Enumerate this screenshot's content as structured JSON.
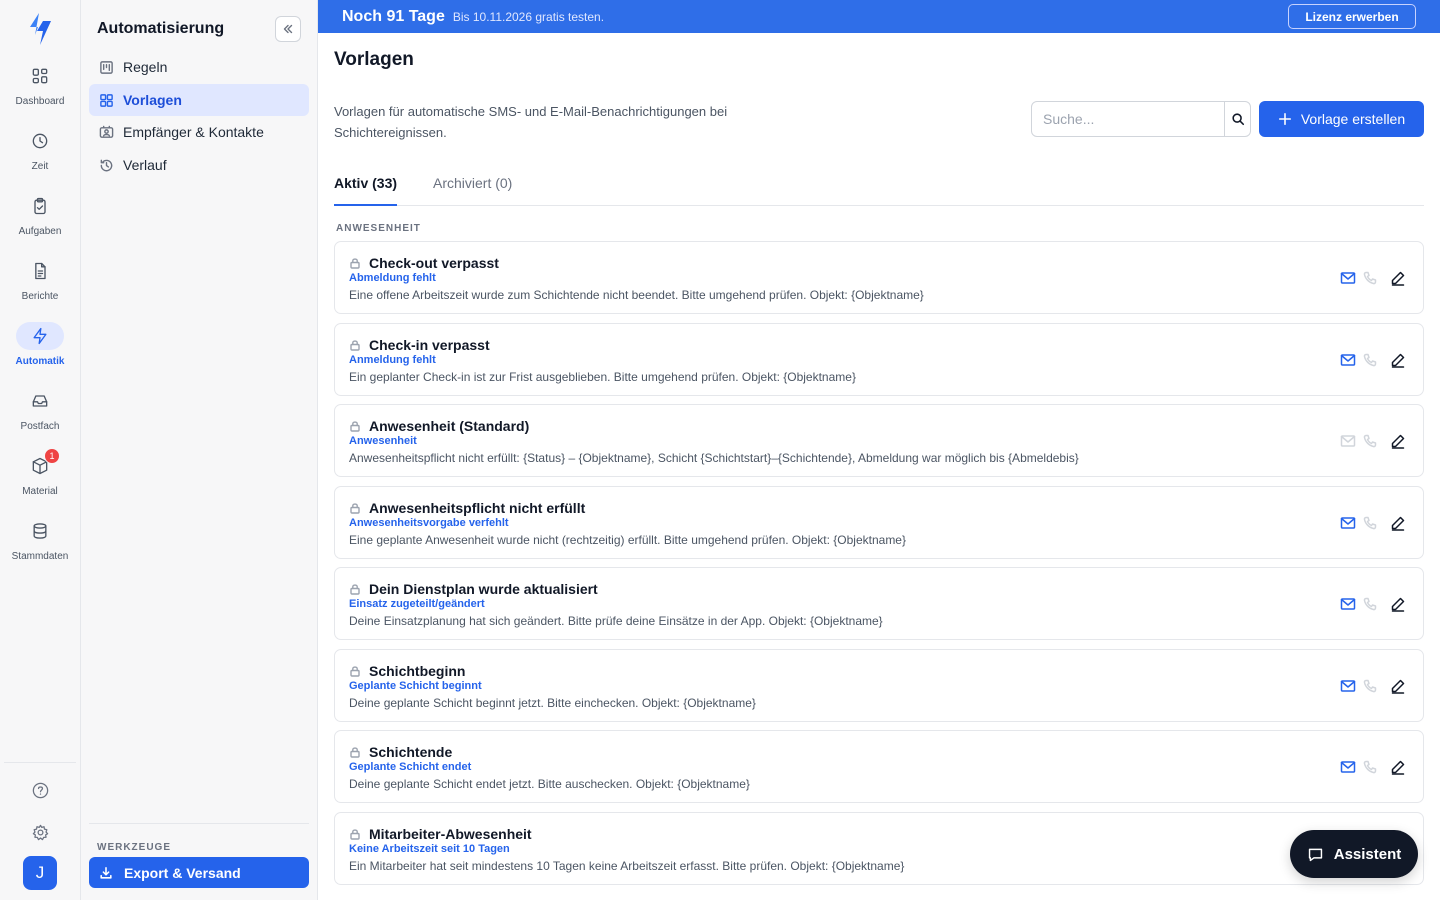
{
  "rail": {
    "items": [
      {
        "label": "Dashboard",
        "icon": "dashboard-icon"
      },
      {
        "label": "Zeit",
        "icon": "clock-icon"
      },
      {
        "label": "Aufgaben",
        "icon": "clipboard-icon"
      },
      {
        "label": "Berichte",
        "icon": "document-icon"
      },
      {
        "label": "Automatik",
        "icon": "lightning-icon"
      },
      {
        "label": "Postfach",
        "icon": "inbox-icon"
      },
      {
        "label": "Material",
        "icon": "box-icon",
        "badge": "1"
      },
      {
        "label": "Stammdaten",
        "icon": "database-icon"
      }
    ],
    "active": "Automatik",
    "avatar_initial": "J"
  },
  "sidebar": {
    "title": "Automatisierung",
    "items": [
      {
        "label": "Regeln"
      },
      {
        "label": "Vorlagen"
      },
      {
        "label": "Empfänger & Kontakte"
      },
      {
        "label": "Verlauf"
      }
    ],
    "active": "Vorlagen",
    "tools_label": "WERKZEUGE",
    "export_label": "Export & Versand"
  },
  "banner": {
    "title": "Noch 91 Tage",
    "subtitle": "Bis 10.11.2026 gratis testen.",
    "license_button": "Lizenz erwerben"
  },
  "main": {
    "title": "Vorlagen",
    "description": "Vorlagen für automatische SMS- und E-Mail-Benachrichtigungen bei Schichtereignissen.",
    "search_placeholder": "Suche...",
    "create_button": "Vorlage erstellen",
    "tabs": [
      {
        "label": "Aktiv (33)",
        "active": true
      },
      {
        "label": "Archiviert (0)",
        "active": false
      }
    ],
    "section_label": "ANWESENHEIT",
    "templates": [
      {
        "title": "Check-out verpasst",
        "subtitle": "Abmeldung fehlt",
        "description": "Eine offene Arbeitszeit wurde zum Schichtende nicht beendet. Bitte umgehend prüfen. Objekt: {Objektname}",
        "email_active": true
      },
      {
        "title": "Check-in verpasst",
        "subtitle": "Anmeldung fehlt",
        "description": "Ein geplanter Check-in ist zur Frist ausgeblieben. Bitte umgehend prüfen. Objekt: {Objektname}",
        "email_active": true
      },
      {
        "title": "Anwesenheit (Standard)",
        "subtitle": "Anwesenheit",
        "description": "Anwesenheitspflicht nicht erfüllt: {Status} – {Objektname}, Schicht {Schichtstart}–{Schichtende}, Abmeldung war möglich bis {Abmeldebis}",
        "email_active": false
      },
      {
        "title": "Anwesenheitspflicht nicht erfüllt",
        "subtitle": "Anwesenheitsvorgabe verfehlt",
        "description": "Eine geplante Anwesenheit wurde nicht (rechtzeitig) erfüllt. Bitte umgehend prüfen. Objekt: {Objektname}",
        "email_active": true
      },
      {
        "title": "Dein Dienstplan wurde aktualisiert",
        "subtitle": "Einsatz zugeteilt/geändert",
        "description": "Deine Einsatzplanung hat sich geändert. Bitte prüfe deine Einsätze in der App. Objekt: {Objektname}",
        "email_active": true
      },
      {
        "title": "Schichtbeginn",
        "subtitle": "Geplante Schicht beginnt",
        "description": "Deine geplante Schicht beginnt jetzt. Bitte einchecken. Objekt: {Objektname}",
        "email_active": true
      },
      {
        "title": "Schichtende",
        "subtitle": "Geplante Schicht endet",
        "description": "Deine geplante Schicht endet jetzt. Bitte auschecken. Objekt: {Objektname}",
        "email_active": true
      },
      {
        "title": "Mitarbeiter-Abwesenheit",
        "subtitle": "Keine Arbeitszeit seit 10 Tagen",
        "description": "Ein Mitarbeiter hat seit mindestens 10 Tagen keine Arbeitszeit erfasst. Bitte prüfen. Objekt: {Objektname}",
        "email_active": true
      }
    ]
  },
  "assistant": {
    "label": "Assistent"
  },
  "colors": {
    "accent": "#2563eb",
    "banner": "#2f6ee8",
    "badge": "#ef4444",
    "assistant": "#111827"
  }
}
